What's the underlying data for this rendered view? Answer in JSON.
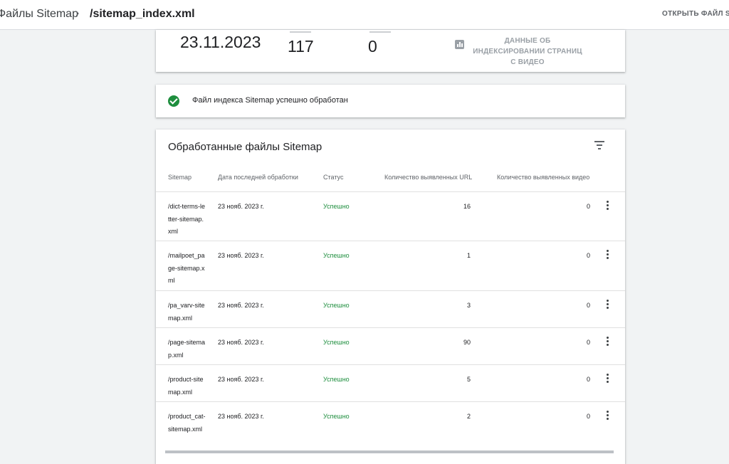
{
  "breadcrumb": {
    "parent": "Файлы Sitemap",
    "separator": "›",
    "current": "/sitemap_index.xml"
  },
  "header_actions": {
    "open_file": "ОТКРЫТЬ ФАЙЛ SI"
  },
  "stats": {
    "date": "23.11.2023",
    "urls": "117",
    "videos": "0",
    "video_link": "ДАННЫЕ ОБ ИНДЕКСИРОВАНИИ СТРАНИЦ С ВИДЕО",
    "video_icon": "bar-chart-icon"
  },
  "status_banner": {
    "icon": "check-circle-icon",
    "message": "Файл индекса Sitemap успешно обработан",
    "color": "#1e8e3e"
  },
  "processed_table": {
    "title": "Обработанные файлы Sitemap",
    "filter_icon": "filter-icon",
    "columns": [
      "Sitemap",
      "Дата последней обработки",
      "Статус",
      "Количество выявленных URL",
      "Количество выявленных видео"
    ],
    "rows": [
      {
        "sitemap": "/dict-terms-letter-sitemap.xml",
        "date": "23 нояб. 2023 г.",
        "status": "Успешно",
        "urls": "16",
        "videos": "0"
      },
      {
        "sitemap": "/mailpoet_page-sitemap.xml",
        "date": "23 нояб. 2023 г.",
        "status": "Успешно",
        "urls": "1",
        "videos": "0"
      },
      {
        "sitemap": "/pa_varv-sitemap.xml",
        "date": "23 нояб. 2023 г.",
        "status": "Успешно",
        "urls": "3",
        "videos": "0"
      },
      {
        "sitemap": "/page-sitemap.xml",
        "date": "23 нояб. 2023 г.",
        "status": "Успешно",
        "urls": "90",
        "videos": "0"
      },
      {
        "sitemap": "/product-sitemap.xml",
        "date": "23 нояб. 2023 г.",
        "status": "Успешно",
        "urls": "5",
        "videos": "0"
      },
      {
        "sitemap": "/product_cat-sitemap.xml",
        "date": "23 нояб. 2023 г.",
        "status": "Успешно",
        "urls": "2",
        "videos": "0"
      }
    ]
  }
}
